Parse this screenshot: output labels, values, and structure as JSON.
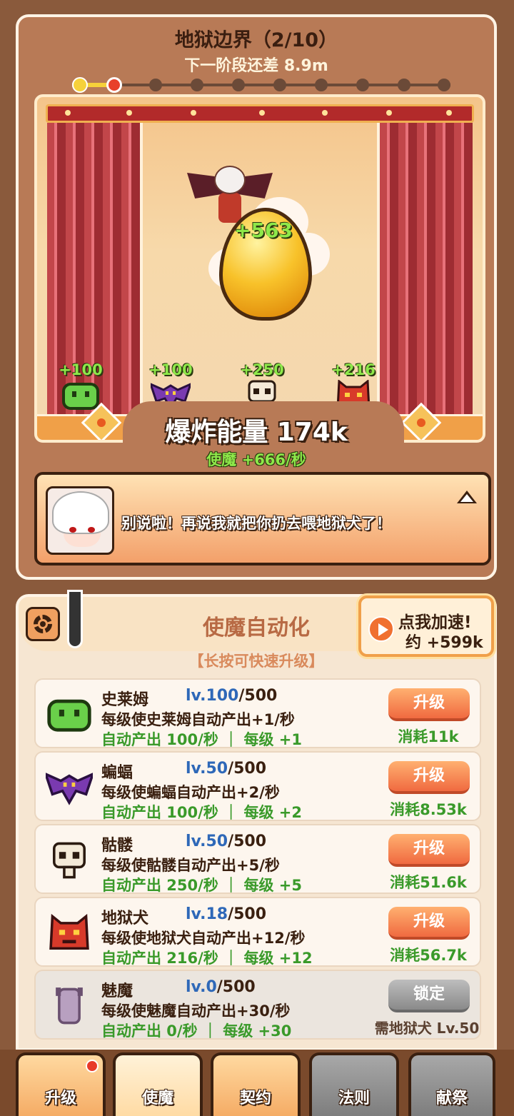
{
  "stage": {
    "title": "地狱边界（2/10）",
    "next_phase": "下一阶段还差 8.9m",
    "progress_total": 10,
    "progress_current": 2
  },
  "scene": {
    "egg_gain": "+563",
    "minions": [
      {
        "name": "slime",
        "gain": "+100"
      },
      {
        "name": "bat",
        "gain": "+100"
      },
      {
        "name": "skeleton",
        "gain": "+250"
      },
      {
        "name": "hellhound",
        "gain": "+216"
      }
    ],
    "energy_label": "爆炸能量 174k",
    "rate_label": "使魔 +666/秒"
  },
  "dialog": {
    "text": "别说啦！再说我就把你扔去喂地狱犬了！"
  },
  "panel": {
    "title": "使魔自动化",
    "hint": "【长按可快速升级】",
    "speed_line1": "点我加速!",
    "speed_line2": "约 +599k"
  },
  "familiars": [
    {
      "name": "史莱姆",
      "level": "lv.100",
      "max": "/500",
      "desc": "每级使史莱姆自动产出+1/秒",
      "auto": "自动产出 100/秒 ｜ 每级 +1",
      "button": "升级",
      "cost": "消耗11k",
      "color": "#6ad04a"
    },
    {
      "name": "蝙蝠",
      "level": "lv.50",
      "max": "/500",
      "desc": "每级使蝙蝠自动产出+2/秒",
      "auto": "自动产出 100/秒 ｜ 每级 +2",
      "button": "升级",
      "cost": "消耗8.53k",
      "color": "#7a3ab0"
    },
    {
      "name": "骷髅",
      "level": "lv.50",
      "max": "/500",
      "desc": "每级使骷髅自动产出+5/秒",
      "auto": "自动产出 250/秒 ｜ 每级 +5",
      "button": "升级",
      "cost": "消耗51.6k",
      "color": "#f4ead8"
    },
    {
      "name": "地狱犬",
      "level": "lv.18",
      "max": "/500",
      "desc": "每级使地狱犬自动产出+12/秒",
      "auto": "自动产出 216/秒 ｜ 每级 +12",
      "button": "升级",
      "cost": "消耗56.7k",
      "color": "#d83a2a"
    },
    {
      "name": "魅魔",
      "level": "lv.0",
      "max": "/500",
      "desc": "每级使魅魔自动产出+30/秒",
      "auto": "自动产出 0/秒 ｜ 每级 +30",
      "button": "锁定",
      "cost": "需地狱犬 Lv.50",
      "color": "#8a6a9a"
    }
  ],
  "tabs": [
    {
      "label": "升级"
    },
    {
      "label": "使魔"
    },
    {
      "label": "契约"
    },
    {
      "label": "法则"
    },
    {
      "label": "献祭"
    }
  ]
}
